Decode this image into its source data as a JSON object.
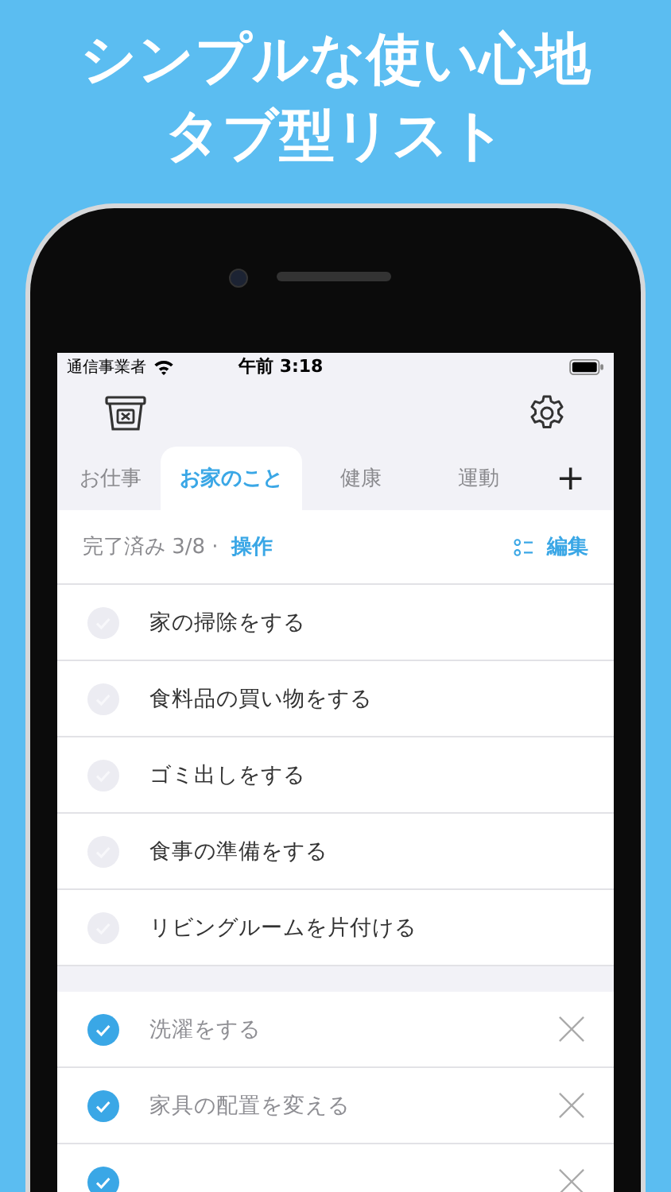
{
  "header": {
    "lines": [
      "シンプルな使い心地",
      "タブ型リスト"
    ]
  },
  "status_bar": {
    "carrier": "通信事業者",
    "time": "午前 3:18"
  },
  "tabs": [
    {
      "label": "お仕事",
      "selected": false
    },
    {
      "label": "お家のこと",
      "selected": true
    },
    {
      "label": "健康",
      "selected": false
    },
    {
      "label": "運動",
      "selected": false
    }
  ],
  "add_tab": "+",
  "summary": {
    "text": "完了済み 3/8 ·",
    "action": "操作",
    "edit": "編集"
  },
  "open_items": [
    {
      "text": "家の掃除をする",
      "checked": false
    },
    {
      "text": "食料品の買い物をする",
      "checked": false
    },
    {
      "text": "ゴミ出しをする",
      "checked": false
    },
    {
      "text": "食事の準備をする",
      "checked": false
    },
    {
      "text": "リビングルームを片付ける",
      "checked": false
    }
  ],
  "done_items": [
    {
      "text": "洗濯をする",
      "checked": true
    },
    {
      "text": "家具の配置を変える",
      "checked": true
    },
    {
      "checked": true
    }
  ]
}
